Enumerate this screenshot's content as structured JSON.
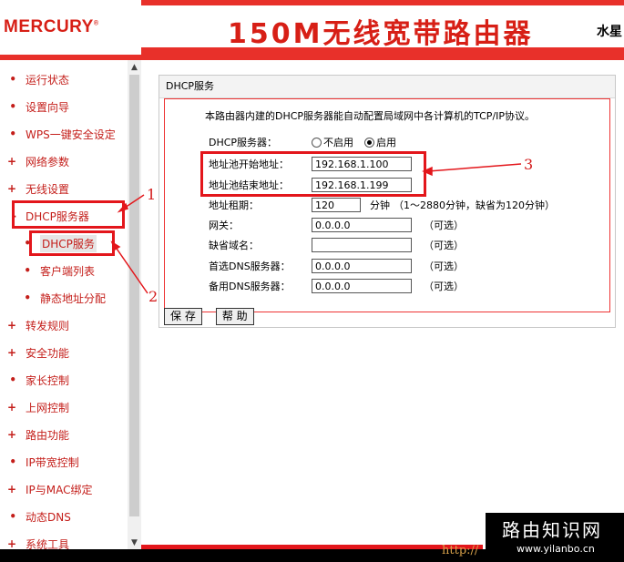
{
  "header": {
    "logo": "MERCURY",
    "logo_mark": "®",
    "title": "150M无线宽带路由器",
    "title_extra": "水星"
  },
  "sidebar": {
    "items": [
      {
        "bullet": "•",
        "label": "运行状态"
      },
      {
        "bullet": "•",
        "label": "设置向导"
      },
      {
        "bullet": "•",
        "label": "WPS一键安全设定"
      },
      {
        "bullet": "+",
        "label": "网络参数"
      },
      {
        "bullet": "+",
        "label": "无线设置"
      },
      {
        "bullet": "-",
        "label": "DHCP服务器"
      },
      {
        "bullet": "•",
        "label": "DHCP服务"
      },
      {
        "bullet": "•",
        "label": "客户端列表"
      },
      {
        "bullet": "•",
        "label": "静态地址分配"
      },
      {
        "bullet": "+",
        "label": "转发规则"
      },
      {
        "bullet": "+",
        "label": "安全功能"
      },
      {
        "bullet": "•",
        "label": "家长控制"
      },
      {
        "bullet": "+",
        "label": "上网控制"
      },
      {
        "bullet": "+",
        "label": "路由功能"
      },
      {
        "bullet": "•",
        "label": "IP带宽控制"
      },
      {
        "bullet": "+",
        "label": "IP与MAC绑定"
      },
      {
        "bullet": "•",
        "label": "动态DNS"
      },
      {
        "bullet": "+",
        "label": "系统工具"
      }
    ]
  },
  "panel": {
    "title": "DHCP服务",
    "intro": "本路由器内建的DHCP服务器能自动配置局域网中各计算机的TCP/IP协议。",
    "dhcp_label": "DHCP服务器：",
    "radio_off": "不启用",
    "radio_on": "启用",
    "start_label": "地址池开始地址：",
    "start_value": "192.168.1.100",
    "end_label": "地址池结束地址：",
    "end_value": "192.168.1.199",
    "lease_label": "地址租期：",
    "lease_value": "120",
    "lease_unit": "分钟",
    "lease_hint": "（1～2880分钟，缺省为120分钟）",
    "gateway_label": "网关：",
    "gateway_value": "0.0.0.0",
    "gateway_hint": "（可选）",
    "domain_label": "缺省域名：",
    "domain_value": "",
    "domain_hint": "（可选）",
    "dns1_label": "首选DNS服务器：",
    "dns1_value": "0.0.0.0",
    "dns1_hint": "（可选）",
    "dns2_label": "备用DNS服务器：",
    "dns2_value": "0.0.0.0",
    "dns2_hint": "（可选）",
    "save_label": "保 存",
    "help_label": "帮 助"
  },
  "annotations": {
    "n1": "1",
    "n2": "2",
    "n3": "3"
  },
  "watermark": {
    "title": "路由知识网",
    "url": "www.yilanbo.cn",
    "http": "http://"
  },
  "colors": {
    "accent": "#e8302a",
    "nav_text": "#c41e1a",
    "annotation": "#e3161b"
  }
}
